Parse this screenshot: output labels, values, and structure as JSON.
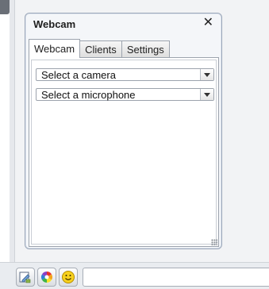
{
  "window": {
    "title": "Webcam",
    "close_label": "✕"
  },
  "tabs": [
    {
      "label": "Webcam",
      "active": true
    },
    {
      "label": "Clients",
      "active": false
    },
    {
      "label": "Settings",
      "active": false
    }
  ],
  "camera_select": {
    "value": "Select a camera"
  },
  "microphone_select": {
    "value": "Select a microphone"
  },
  "toolbar": {
    "icons": [
      "edit-icon",
      "color-wheel-icon",
      "smiley-icon"
    ]
  }
}
